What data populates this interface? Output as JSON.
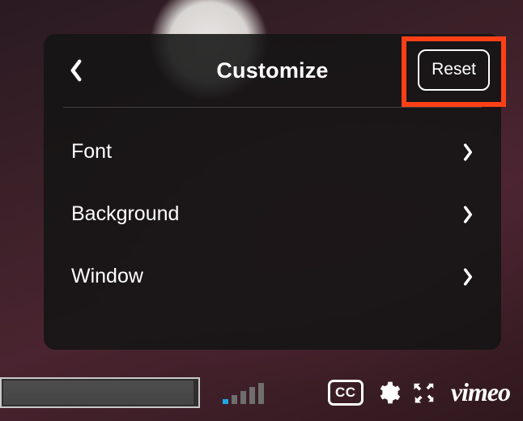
{
  "panel": {
    "title": "Customize",
    "reset_label": "Reset",
    "items": [
      {
        "label": "Font"
      },
      {
        "label": "Background"
      },
      {
        "label": "Window"
      }
    ]
  },
  "player": {
    "cc_label": "CC",
    "brand": "vimeo"
  },
  "highlight": {
    "color": "#ff4017"
  }
}
